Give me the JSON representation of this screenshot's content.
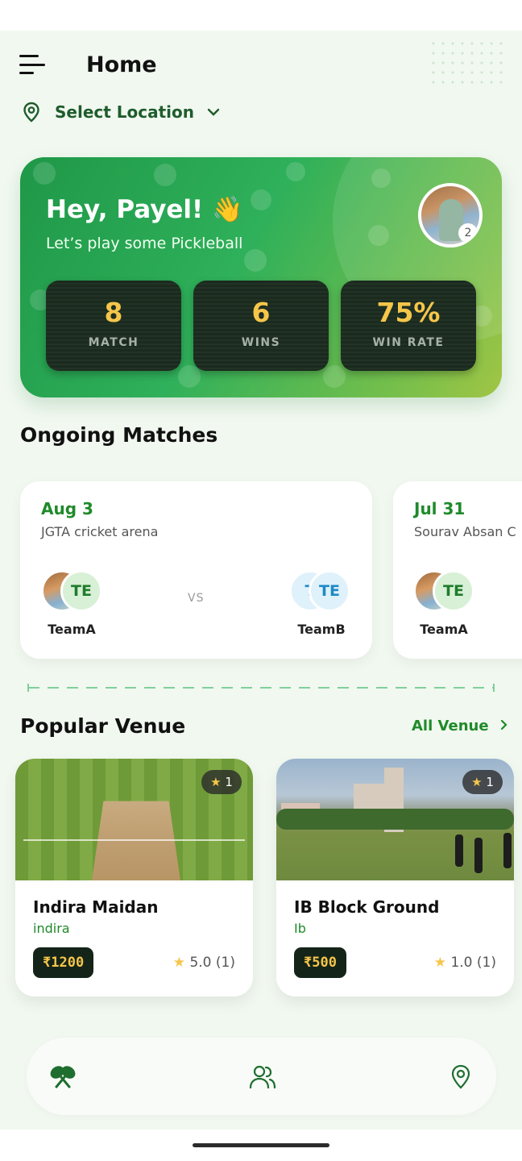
{
  "header": {
    "title": "Home",
    "menu_icon": "hamburger-menu-icon"
  },
  "location": {
    "label": "Select Location",
    "icon": "location-pin-icon",
    "chevron": "chevron-down-icon"
  },
  "hero": {
    "greeting": "Hey, Payel! 👋",
    "subtitle": "Let’s play some Pickleball",
    "avatar_badge": "2",
    "stats": [
      {
        "value": "8",
        "label": "MATCH"
      },
      {
        "value": "6",
        "label": "WINS"
      },
      {
        "value": "75%",
        "label": "WIN RATE"
      }
    ]
  },
  "ongoing": {
    "title": "Ongoing Matches",
    "matches": [
      {
        "date": "Aug 3",
        "venue": "JGTA cricket arena",
        "vs": "VS",
        "team_a": {
          "name": "TeamA",
          "initials": "TE"
        },
        "team_b": {
          "name": "TeamB",
          "initials": "TE",
          "back_initial": "T"
        }
      },
      {
        "date": "Jul 31",
        "venue": "Sourav Absan C",
        "team_a": {
          "name": "TeamA",
          "initials": "TE"
        }
      }
    ]
  },
  "popular": {
    "title": "Popular Venue",
    "all_label": "All Venue",
    "venues": [
      {
        "name": "Indira Maidan",
        "slug": "indira",
        "price": "₹1200",
        "tag_rating": "1",
        "rating": "5.0",
        "reviews": "(1)"
      },
      {
        "name": "IB Block Ground",
        "slug": "Ib",
        "price": "₹500",
        "tag_rating": "1",
        "rating": "1.0",
        "reviews": "(1)"
      }
    ]
  },
  "bottom_nav": {
    "items": [
      "pickleball-paddles-icon",
      "users-icon",
      "location-pin-icon"
    ]
  },
  "colors": {
    "brand_green": "#1f8a2a",
    "accent_yellow": "#f5c64a",
    "background": "#f1f8f0"
  }
}
